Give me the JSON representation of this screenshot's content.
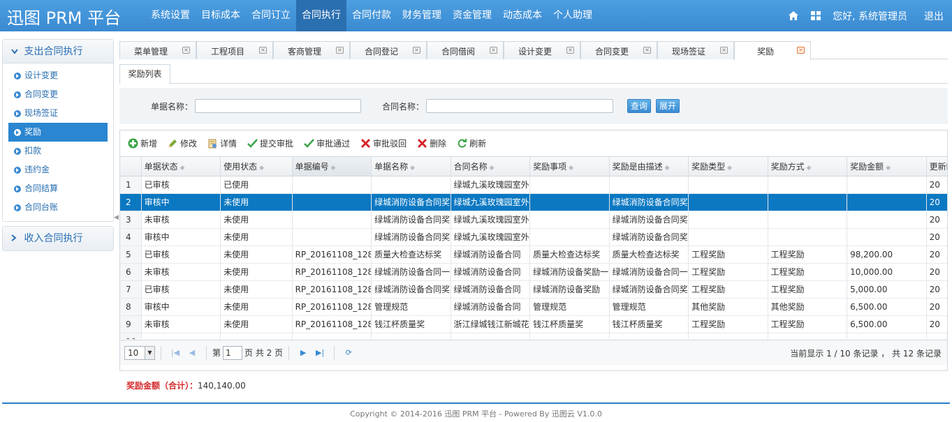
{
  "app": {
    "logo": "迅图 PRM 平台"
  },
  "topnav": [
    "系统设置",
    "目标成本",
    "合同订立",
    "合同执行",
    "合同付款",
    "财务管理",
    "资金管理",
    "动态成本",
    "个人助理"
  ],
  "topnav_active": "合同执行",
  "header": {
    "greeting": "您好, 系统管理员",
    "logout": "退出",
    "icons": [
      "home-icon",
      "grid-icon"
    ]
  },
  "sidebar": {
    "group1": "支出合同执行",
    "items": [
      "设计变更",
      "合同变更",
      "现场签证",
      "奖励",
      "扣款",
      "违约金",
      "合同结算",
      "合同台账"
    ],
    "active": "奖励",
    "group2": "收入合同执行"
  },
  "tabs": [
    "菜单管理",
    "工程项目",
    "客商管理",
    "合同登记",
    "合同借阅",
    "设计变更",
    "合同变更",
    "现场签证",
    "奖励"
  ],
  "active_tab": "奖励",
  "subtab": "奖励列表",
  "search": {
    "label1": "单据名称：",
    "label2": "合同名称：",
    "query_btn": "查询",
    "expand_btn": "展开"
  },
  "toolbar": [
    "新增",
    "修改",
    "详情",
    "提交审批",
    "审批通过",
    "审批驳回",
    "删除",
    "刷新"
  ],
  "columns": [
    "单据状态",
    "使用状态",
    "单据编号",
    "单据名称",
    "合同名称",
    "奖励事项",
    "奖励是由描述",
    "奖励类型",
    "奖励方式",
    "奖励金额",
    "更新时"
  ],
  "rows": [
    [
      "1",
      "已审核",
      "已使用",
      "",
      "",
      "绿城九溪玫瑰园室外",
      "",
      "",
      "",
      "",
      "",
      "20"
    ],
    [
      "2",
      "审核中",
      "未使用",
      "",
      "绿城消防设备合同奖",
      "绿城九溪玫瑰园室外",
      "",
      "绿城消防设备合同奖",
      "",
      "",
      "",
      "20"
    ],
    [
      "3",
      "未审核",
      "未使用",
      "",
      "绿城消防设备合同奖",
      "绿城九溪玫瑰园室外",
      "",
      "绿城消防设备合同奖",
      "",
      "",
      "",
      "20"
    ],
    [
      "4",
      "审核中",
      "未使用",
      "",
      "绿城消防设备合同奖",
      "绿城九溪玫瑰园室外",
      "",
      "绿城消防设备合同奖",
      "",
      "",
      "",
      "20"
    ],
    [
      "5",
      "已审核",
      "未使用",
      "RP_20161108_128",
      "质量大检查达标奖",
      "绿城消防设备合同",
      "质量大检查达标奖",
      "质量大检查达标奖",
      "工程奖励",
      "工程奖励",
      "98,200.00",
      "20"
    ],
    [
      "6",
      "未审核",
      "未使用",
      "RP_20161108_128",
      "绿城消防设备合同一",
      "绿城消防设备合同",
      "绿城消防设备奖励一",
      "绿城消防设备合同一",
      "工程奖励",
      "工程奖励",
      "10,000.00",
      "20"
    ],
    [
      "7",
      "已审核",
      "未使用",
      "RP_20161108_128",
      "绿城消防设备合同奖",
      "绿城消防设备合同",
      "绿城消防设备奖励",
      "绿城消防设备合同奖",
      "工程奖励",
      "工程奖励",
      "5,000.00",
      "20"
    ],
    [
      "8",
      "审核中",
      "未使用",
      "RP_20161108_128",
      "管理规范",
      "绿城消防设备合同",
      "管理规范",
      "管理规范",
      "其他奖励",
      "其他奖励",
      "6,500.00",
      "20"
    ],
    [
      "9",
      "未审核",
      "未使用",
      "RP_20161108_128",
      "钱江杯质量奖",
      "浙江绿城钱江新城花",
      "钱江杯质量奖",
      "钱江杯质量奖",
      "工程奖励",
      "工程奖励",
      "6,500.00",
      "20"
    ],
    [
      "10",
      "",
      "",
      "",
      "",
      "",
      "",
      "",
      "",
      "",
      "",
      ""
    ]
  ],
  "selected_row": 2,
  "pager": {
    "page_size": "10",
    "page_prefix": "第",
    "page_value": "1",
    "page_suffix": "页 共 2 页",
    "info": "当前显示 1 / 10 条记录 ， 共 12 条记录"
  },
  "total": {
    "label": "奖励金额（合计）：",
    "value": "140,140.00"
  },
  "footer": "Copyright © 2014-2016 迅图 PRM 平台 - Powered By 迅图云 V1.0.0"
}
